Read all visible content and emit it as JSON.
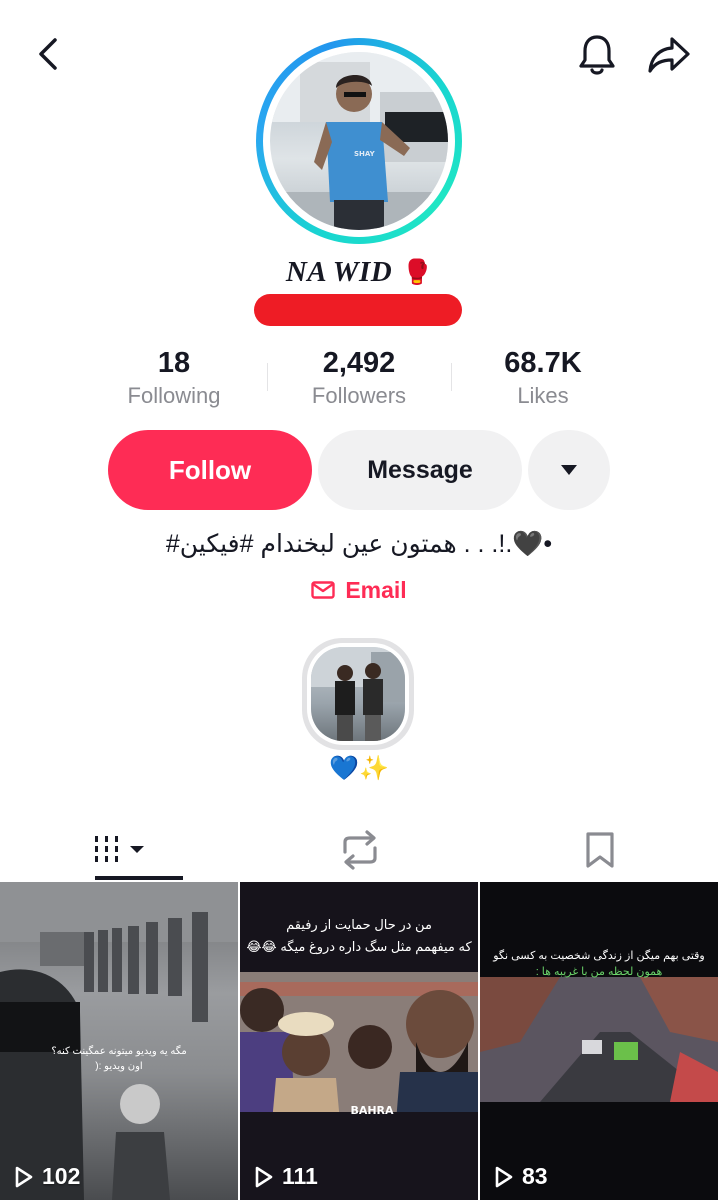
{
  "profile": {
    "display_name": "NA WID",
    "display_name_emoji": "🥊"
  },
  "stats": [
    {
      "value": "18",
      "label": "Following"
    },
    {
      "value": "2,492",
      "label": "Followers"
    },
    {
      "value": "68.7K",
      "label": "Likes"
    }
  ],
  "actions": {
    "follow_label": "Follow",
    "message_label": "Message"
  },
  "bio": "#همتون عین لبخندام #فیکین . . .!.🖤•",
  "email_label": "Email",
  "highlight": {
    "caption": "💙✨"
  },
  "videos": [
    {
      "views": "102",
      "caption_lines": [
        "مگه یه ویدیو میتونه عمگینت کنه؟",
        "اون ویدیو :("
      ]
    },
    {
      "views": "111",
      "caption_lines": [
        "من در حال حمایت از رفیقم",
        "که میفهمم مثل سگ داره دروغ میگه 😂😂"
      ],
      "watermark": "BAHRA"
    },
    {
      "views": "83",
      "caption_lines": [
        "وقتی بهم میگن از زندگی شخصیت به کسی نگو",
        "همون لحظه من با غریبه ها :"
      ]
    }
  ],
  "colors": {
    "accent": "#fe2c55",
    "text": "#161823",
    "secondary_text": "#8a8b91",
    "button_gray": "#f1f1f2",
    "redaction": "#ee1c25"
  },
  "icons": {
    "back": "chevron-left-icon",
    "bell": "bell-icon",
    "share": "share-arrow-icon",
    "more": "caret-down-icon",
    "email": "envelope-icon",
    "videos_tab": "grid-icon",
    "reposts_tab": "repost-icon",
    "favorites_tab": "bookmark-icon",
    "play": "play-icon"
  }
}
